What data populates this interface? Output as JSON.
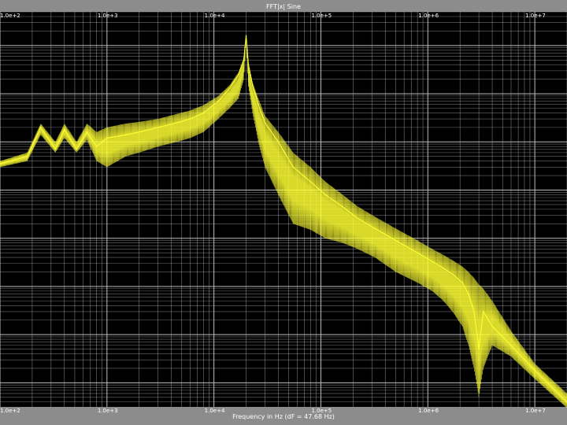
{
  "window": {
    "title": "FFT|x| Sine"
  },
  "chart_data": {
    "type": "line",
    "title": "FFT|x| Sine",
    "xlabel": "Frequency in Hz (dF = 47.68 Hz)",
    "ylabel": "",
    "x_scale": "log",
    "y_scale": "log",
    "xlim": [
      100,
      20000000
    ],
    "grid": true,
    "background_color": "#000000",
    "frame_color": "#8c8c8c",
    "grid_color": "#c8c8c8",
    "line_color": "#ffff33",
    "x_ticks": [
      {
        "value": 100,
        "label": "1.0e+2"
      },
      {
        "value": 1000,
        "label": "1.0e+3"
      },
      {
        "value": 10000,
        "label": "1.0e+4"
      },
      {
        "value": 100000,
        "label": "1.0e+5"
      },
      {
        "value": 1000000,
        "label": "1.0e+6"
      },
      {
        "value": 10000000,
        "label": "1.0e+7"
      }
    ],
    "series": [
      {
        "x": [
          100,
          180,
          240,
          330,
          400,
          520,
          650,
          800,
          1000,
          1500,
          2000,
          3000,
          4500,
          6000,
          8000,
          11000,
          14000,
          17000,
          19000,
          19500,
          20000,
          20500,
          21000,
          23000,
          26000,
          30000,
          40000,
          55000,
          80000,
          110000,
          160000,
          220000,
          320000,
          500000,
          800000,
          1100000,
          1400000,
          1700000,
          2100000,
          2400000,
          2700000,
          3000000,
          3300000,
          4000000,
          6000000,
          10000000,
          20000000
        ],
        "y": [
          3.5e-05,
          5e-05,
          0.0002,
          7e-05,
          0.00018,
          7e-05,
          0.00016,
          8e-05,
          0.00012,
          0.00014,
          0.00016,
          0.0002,
          0.00025,
          0.0003,
          0.0004,
          0.0007,
          0.0013,
          0.0025,
          0.005,
          0.009,
          0.016,
          0.008,
          0.004,
          0.0015,
          0.0006,
          0.00025,
          0.0001,
          3e-05,
          1.5e-05,
          8e-06,
          4.5e-06,
          2.6e-06,
          1.6e-06,
          9e-07,
          5e-07,
          3.3e-07,
          2.4e-07,
          1.8e-07,
          1.2e-07,
          7e-08,
          3e-08,
          5e-09,
          3e-08,
          1.5e-08,
          6e-09,
          1.8e-09,
          4e-10
        ],
        "envelope_high": [
          4e-05,
          6e-05,
          0.00024,
          0.0001,
          0.00024,
          0.0001,
          0.00024,
          0.00016,
          0.0002,
          0.00024,
          0.00026,
          0.0003,
          0.00038,
          0.00045,
          0.00058,
          0.0009,
          0.0015,
          0.0028,
          0.0055,
          0.0095,
          0.016,
          0.0085,
          0.0045,
          0.0017,
          0.0008,
          0.00035,
          0.00016,
          6e-05,
          3e-05,
          1.5e-05,
          8e-06,
          4.6e-06,
          2.8e-06,
          1.6e-06,
          9e-07,
          6e-07,
          4.5e-07,
          3.5e-07,
          2.6e-07,
          2e-07,
          1.5e-07,
          1.1e-07,
          9e-08,
          5e-08,
          1.2e-08,
          2.5e-09,
          6e-10
        ],
        "envelope_low": [
          3e-05,
          4e-05,
          0.00014,
          6e-05,
          0.00012,
          6e-05,
          0.00011,
          4e-05,
          3e-05,
          5e-05,
          6e-05,
          8e-05,
          0.0001,
          0.00012,
          0.00016,
          0.0003,
          0.0005,
          0.0008,
          0.002,
          0.005,
          0.015,
          0.004,
          0.0014,
          0.0004,
          0.0001,
          3e-05,
          8e-06,
          2e-06,
          1.5e-06,
          1e-06,
          8e-07,
          6e-07,
          4e-07,
          2e-07,
          1.2e-07,
          8e-08,
          5e-08,
          3e-08,
          1.5e-08,
          6e-09,
          2e-09,
          5e-10,
          2e-09,
          6e-09,
          3.5e-09,
          1.2e-09,
          3e-10
        ]
      }
    ]
  }
}
